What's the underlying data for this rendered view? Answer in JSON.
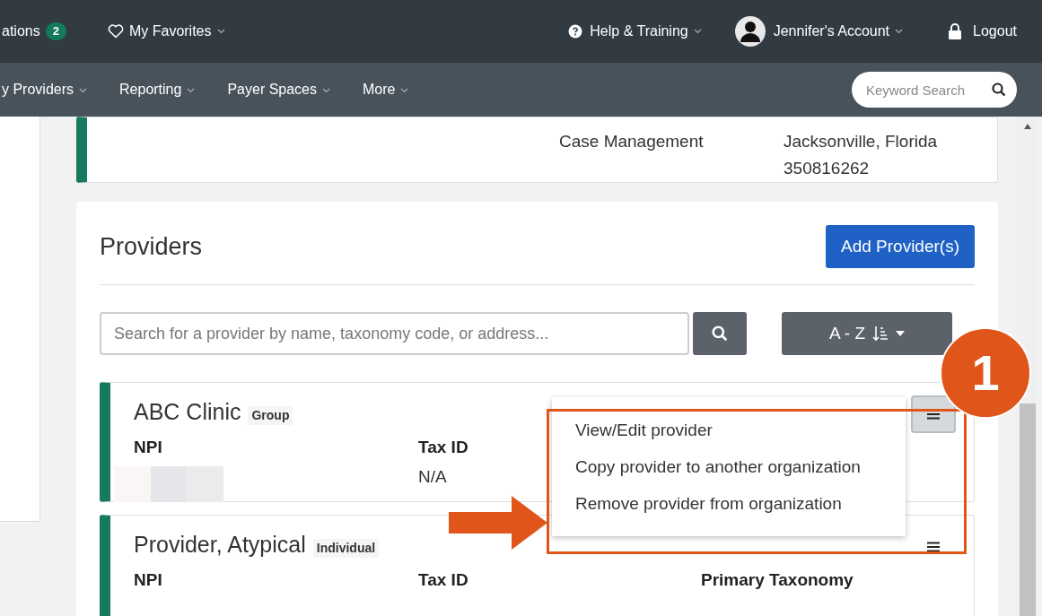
{
  "top_nav": {
    "notifications": {
      "label": "ations",
      "badge": "2"
    },
    "favorites": "My Favorites",
    "help": "Help & Training",
    "account": "Jennifer's Account",
    "logout": "Logout"
  },
  "sub_nav": {
    "items": [
      "y Providers",
      "Reporting",
      "Payer Spaces",
      "More"
    ],
    "search_placeholder": "Keyword Search"
  },
  "summary_card": {
    "taxonomy": "Case Management",
    "address": [
      "Jacksonville, Florida",
      "350816262"
    ]
  },
  "providers": {
    "title": "Providers",
    "add_button": "Add Provider(s)",
    "search_placeholder": "Search for a provider by name, taxonomy code, or address...",
    "sort_button": "A - Z",
    "cards": [
      {
        "name": "ABC Clinic",
        "type": "Group",
        "menu_open": true,
        "columns": [
          {
            "label": "NPI",
            "value_hidden": true
          },
          {
            "label": "Tax ID",
            "value": "N/A"
          }
        ]
      },
      {
        "name": "Provider, Atypical",
        "type": "Individual",
        "menu_open": false,
        "columns": [
          {
            "label": "NPI"
          },
          {
            "label": "Tax ID"
          },
          {
            "label": "Primary Taxonomy"
          }
        ]
      }
    ],
    "menu": [
      "View/Edit provider",
      "Copy provider to another organization",
      "Remove provider from organization"
    ]
  },
  "callout": "1"
}
